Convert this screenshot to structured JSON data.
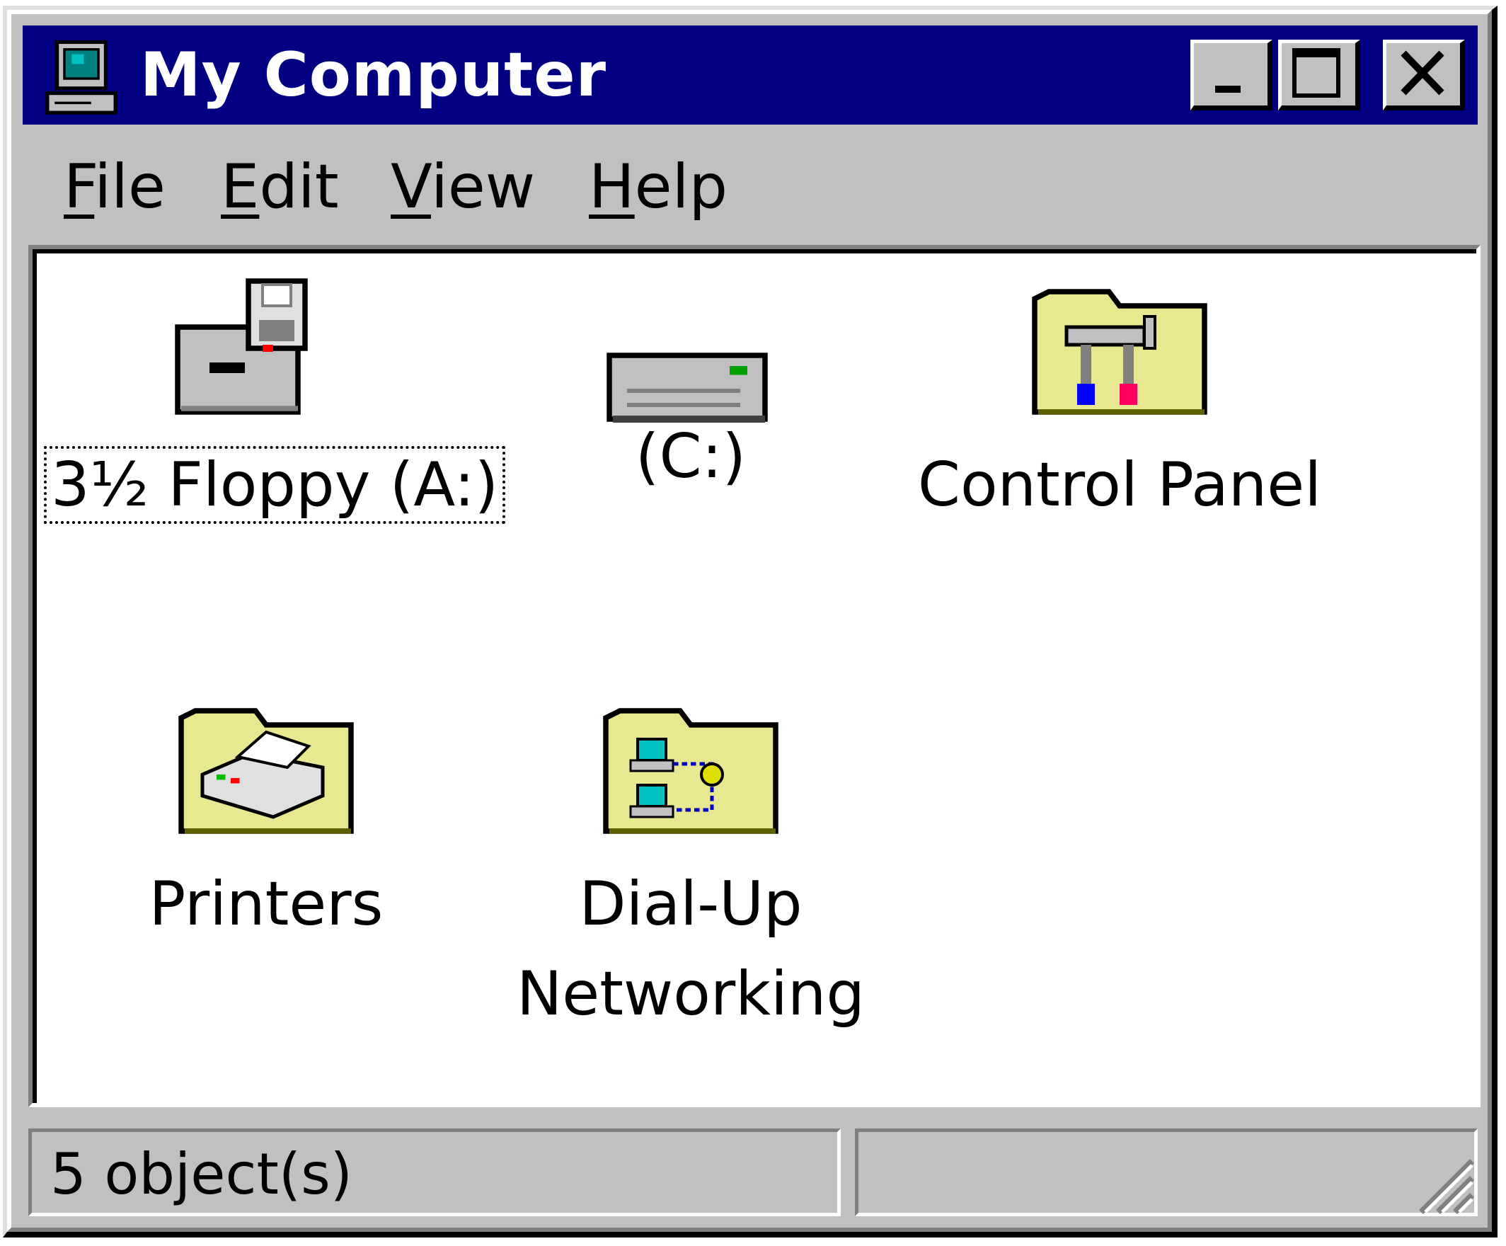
{
  "window": {
    "title": "My Computer",
    "title_icon": "my-computer-icon",
    "controls": {
      "minimize_icon": "minimize-icon",
      "maximize_icon": "maximize-icon",
      "close_icon": "close-icon"
    }
  },
  "menu": [
    {
      "accel": "F",
      "rest": "ile"
    },
    {
      "accel": "E",
      "rest": "dit"
    },
    {
      "accel": "V",
      "rest": "iew"
    },
    {
      "accel": "H",
      "rest": "elp"
    }
  ],
  "items": [
    {
      "label": "3½ Floppy (A:)",
      "icon": "floppy-drive-icon",
      "focused": true
    },
    {
      "label": "(C:)",
      "icon": "hard-drive-icon",
      "focused": false
    },
    {
      "label": "Control Panel",
      "icon": "control-panel-folder-icon",
      "focused": false
    },
    {
      "label": "Printers",
      "icon": "printers-folder-icon",
      "focused": false
    },
    {
      "label_line1": "Dial-Up",
      "label_line2": "Networking",
      "icon": "dial-up-networking-folder-icon",
      "focused": false
    }
  ],
  "status": {
    "objects": "5 object(s)",
    "right": ""
  },
  "colors": {
    "titlebar": "#000080",
    "face": "#c0c0c0",
    "content": "#ffffff",
    "folder": "#e8e890"
  }
}
